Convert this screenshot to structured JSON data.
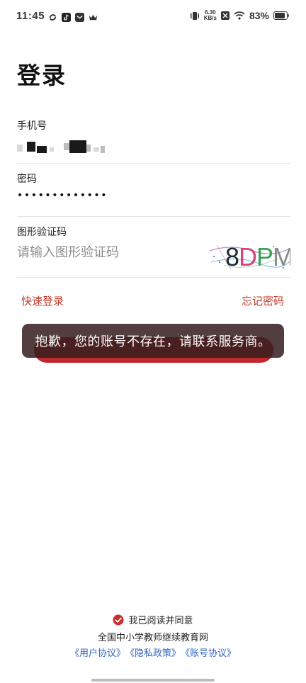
{
  "status_bar": {
    "time": "11:45",
    "net_speed_value": "6.30",
    "net_speed_unit": "KB/s",
    "battery": "83%"
  },
  "title": "登录",
  "phone": {
    "label": "手机号"
  },
  "password": {
    "label": "密码",
    "masked_value": "•••••••••••••"
  },
  "captcha": {
    "label": "图形验证码",
    "placeholder": "请输入图形验证码",
    "image_text": "8DPM"
  },
  "links": {
    "quick_login": "快速登录",
    "forgot_password": "忘记密码"
  },
  "toast": {
    "message": "抱歉，您的账号不存在，请联系服务商。"
  },
  "footer": {
    "agree": "我已阅读并同意",
    "site_name": "全国中小学教师继续教育网",
    "user_agreement": "《用户协议》",
    "privacy_policy": "《隐私政策》",
    "account_agreement": "《账号协议》"
  },
  "colors": {
    "accent_red": "#c0392b",
    "link_blue": "#2e63c5"
  }
}
